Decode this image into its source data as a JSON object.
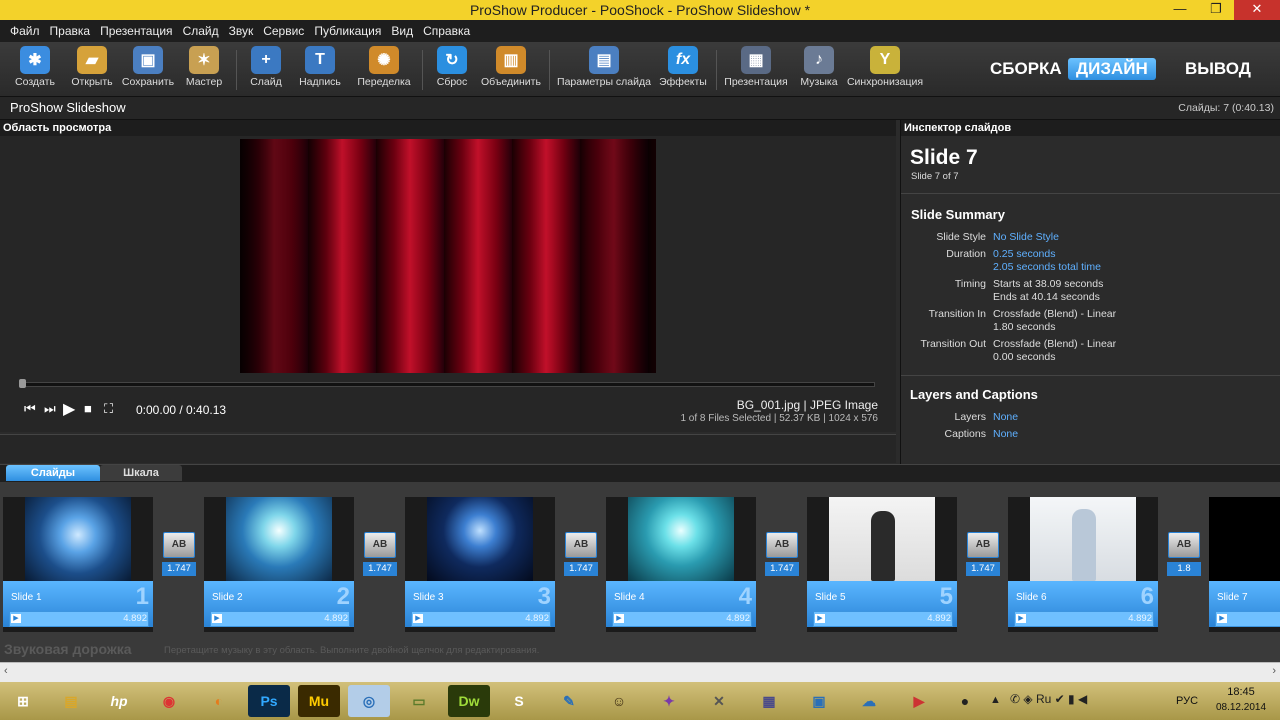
{
  "window": {
    "title": "ProShow Producer - PooShock - ProShow Slideshow *",
    "min_icon": "minimize-icon",
    "restore_icon": "restore-icon",
    "close_icon": "close-icon"
  },
  "menu": [
    "Файл",
    "Правка",
    "Презентация",
    "Слайд",
    "Звук",
    "Сервис",
    "Публикация",
    "Вид",
    "Справка"
  ],
  "toolbar": {
    "buttons": [
      {
        "label": "Создать",
        "icon": "new-project-icon",
        "color": "#3b8de0"
      },
      {
        "label": "Открыть",
        "icon": "open-folder-icon",
        "color": "#d6a23a"
      },
      {
        "label": "Сохранить",
        "icon": "save-icon",
        "color": "#4b7fc1"
      },
      {
        "label": "Мастер",
        "icon": "wizard-icon",
        "color": "#c8a052"
      },
      {
        "label": "Слайд",
        "icon": "add-slide-icon",
        "color": "#3b79c2"
      },
      {
        "label": "Надпись",
        "icon": "caption-icon",
        "color": "#3b79c2"
      },
      {
        "label": "Переделка",
        "icon": "remix-icon",
        "color": "#d08a2a"
      },
      {
        "label": "Сброс",
        "icon": "reset-icon",
        "color": "#2b8fe0"
      },
      {
        "label": "Объединить",
        "icon": "merge-icon",
        "color": "#d08a2a"
      },
      {
        "label": "Параметры слайда",
        "icon": "slide-options-icon",
        "color": "#4b7fc1"
      },
      {
        "label": "Эффекты",
        "icon": "effects-icon",
        "color": "#2b8fe0"
      },
      {
        "label": "Презентация",
        "icon": "show-options-icon",
        "color": "#5a6a85"
      },
      {
        "label": "Музыка",
        "icon": "music-icon",
        "color": "#6b7b95"
      },
      {
        "label": "Синхронизация",
        "icon": "sync-icon",
        "color": "#c9b23a"
      }
    ],
    "modes": {
      "build": "СБОРКА",
      "design": "ДИЗАЙН",
      "output": "ВЫВОД"
    }
  },
  "project": {
    "name": "ProShow Slideshow",
    "summary": "Слайды: 7 (0:40.13)"
  },
  "preview": {
    "title": "Область просмотра",
    "time": "0:00.00 / 0:40.13",
    "file": "BG_001.jpg  |  JPEG Image",
    "file_info": "1 of 8 Files Selected |  52.37 KB  |  1024 x 576"
  },
  "inspector": {
    "title": "Инспектор слайдов",
    "slide_title": "Slide 7",
    "slide_sub": "Slide 7 of 7",
    "summary_title": "Slide Summary",
    "rows": [
      {
        "label": "Slide Style",
        "v1": "No Slide Style",
        "v2": ""
      },
      {
        "label": "Duration",
        "v1": "0.25 seconds",
        "v2": "2.05 seconds total time"
      },
      {
        "label": "Timing",
        "v1": "Starts at 38.09 seconds",
        "v2": "Ends at 40.14 seconds"
      },
      {
        "label": "Transition In",
        "v1": "Crossfade (Blend) - Linear",
        "v2": "1.80 seconds"
      },
      {
        "label": "Transition Out",
        "v1": "Crossfade (Blend) - Linear",
        "v2": "0.00 seconds"
      }
    ],
    "layers_title": "Layers and Captions",
    "layers_label": "Layers",
    "layers_val": "None",
    "captions_label": "Captions",
    "captions_val": "None"
  },
  "tabs": {
    "slides": "Слайды",
    "timeline": "Шкала"
  },
  "slides": [
    {
      "name": "Slide 1",
      "num": "1",
      "dur": "4.892",
      "thumb": "#1c4e8a"
    },
    {
      "name": "Slide 2",
      "num": "2",
      "dur": "4.892",
      "thumb": "#2a7ab8"
    },
    {
      "name": "Slide 3",
      "num": "3",
      "dur": "4.892",
      "thumb": "#0f2a5e"
    },
    {
      "name": "Slide 4",
      "num": "4",
      "dur": "4.892",
      "thumb": "#2a9bb0"
    },
    {
      "name": "Slide 5",
      "num": "5",
      "dur": "4.892",
      "thumb": "#e8e8e8"
    },
    {
      "name": "Slide 6",
      "num": "6",
      "dur": "4.892",
      "thumb": "#e2e6ea"
    },
    {
      "name": "Slide 7",
      "num": "",
      "dur": "",
      "thumb": "#000000"
    }
  ],
  "transitions": [
    {
      "label": "AB",
      "val": "1.747"
    },
    {
      "label": "AB",
      "val": "1.747"
    },
    {
      "label": "AB",
      "val": "1.747"
    },
    {
      "label": "AB",
      "val": "1.747"
    },
    {
      "label": "AB",
      "val": "1.747"
    },
    {
      "label": "AB",
      "val": "1.8"
    }
  ],
  "audio": {
    "title": "Звуковая дорожка",
    "hint": "Перетащите музыку в эту область. Выполните двойной щелчок для редактирования."
  },
  "taskbar": {
    "apps": [
      {
        "name": "windows-start-icon",
        "label": "⊞"
      },
      {
        "name": "explorer-icon",
        "label": "▤"
      },
      {
        "name": "hp-icon",
        "label": "hp"
      },
      {
        "name": "chrome-icon",
        "label": "◉"
      },
      {
        "name": "firefox-icon",
        "label": "◐"
      },
      {
        "name": "photoshop-icon",
        "label": "Ps"
      },
      {
        "name": "muse-icon",
        "label": "Mu"
      },
      {
        "name": "proshow-icon",
        "label": "◎"
      },
      {
        "name": "notes-icon",
        "label": "▭"
      },
      {
        "name": "dreamweaver-icon",
        "label": "Dw"
      },
      {
        "name": "skype-icon",
        "label": "S"
      },
      {
        "name": "paint-icon",
        "label": "✎"
      },
      {
        "name": "gimp-icon",
        "label": "☺"
      },
      {
        "name": "tool-icon",
        "label": "✦"
      },
      {
        "name": "tools-icon",
        "label": "✕"
      },
      {
        "name": "document-icon",
        "label": "▦"
      },
      {
        "name": "monitor-icon",
        "label": "▣"
      },
      {
        "name": "network-icon",
        "label": "☁"
      },
      {
        "name": "presentation-icon",
        "label": "▶"
      },
      {
        "name": "camera-icon",
        "label": "●"
      }
    ],
    "lang": "РУС",
    "time": "18:45",
    "date": "08.12.2014"
  }
}
